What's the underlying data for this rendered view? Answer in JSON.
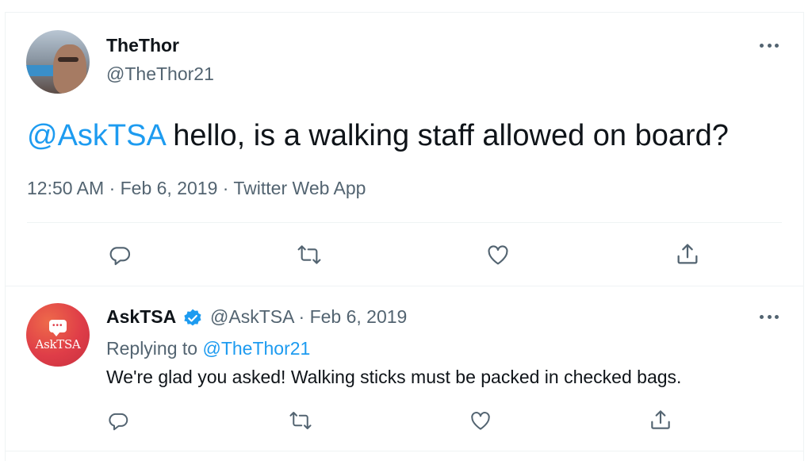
{
  "main_tweet": {
    "display_name": "TheThor",
    "handle": "@TheThor21",
    "mention": "@AskTSA",
    "text": " hello, is a walking staff allowed on board?",
    "meta": "12:50 AM · Feb 6, 2019 · Twitter Web App",
    "actions": [
      "reply-icon",
      "retweet-icon",
      "like-icon",
      "share-icon"
    ]
  },
  "reply_tweet": {
    "display_name": "AskTSA",
    "handle_date": "@AskTSA · Feb 6, 2019",
    "replying_prefix": "Replying to ",
    "replying_to": "@TheThor21",
    "text": "We're glad you asked! Walking sticks must be packed in checked bags.",
    "avatar_label": "AskTSA",
    "actions": [
      "reply-icon",
      "retweet-icon",
      "like-icon",
      "share-icon"
    ]
  },
  "colors": {
    "accent": "#1d9bf0",
    "secondary_text": "#536471",
    "primary_text": "#0f1419",
    "divider": "#eff3f4",
    "tsa_red": "#df3d48"
  }
}
